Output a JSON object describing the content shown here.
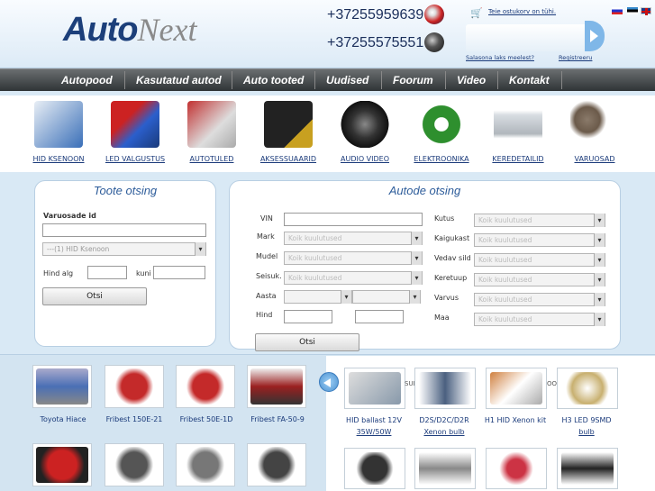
{
  "header": {
    "logo": {
      "part1": "Auto",
      "part2": "Next"
    },
    "phones": [
      "+37255959639",
      "+37255575551"
    ],
    "cart": {
      "link": "Teie ostukorv on tühi.",
      "forgot": "Salasona laks meelest?",
      "register": "Registreeru"
    },
    "languages": [
      "ru",
      "ee",
      "en"
    ]
  },
  "nav": {
    "items": [
      "Autopood",
      "Kasutatud autod",
      "Auto tooted",
      "Uudised",
      "Foorum",
      "Video",
      "Kontakt"
    ]
  },
  "categories": [
    {
      "label": "HID KSENOON",
      "color": "#3a6fb8"
    },
    {
      "label": "LED VALGUSTUS",
      "color": "#2b5fcc"
    },
    {
      "label": "AUTOTULED",
      "color": "#c23030"
    },
    {
      "label": "AKSESSUAARID",
      "color": "#c8a020"
    },
    {
      "label": "AUDIO VIDEO",
      "color": "#333333"
    },
    {
      "label": "ELEKTROONIKA",
      "color": "#2e8f2e"
    },
    {
      "label": "KEREDETAILID",
      "color": "#b0b6bc"
    },
    {
      "label": "VARUOSAD",
      "color": "#6b5a4a"
    }
  ],
  "toote": {
    "title": "Toote otsing",
    "varuosade_label": "Varuosade id",
    "category_select": "---(1) HID Ksenoon",
    "hind_alg": "Hind alg",
    "kuni": "kuni",
    "search_button": "Otsi"
  },
  "autode": {
    "title": "Autode otsing",
    "left_labels": [
      "VIN",
      "Mark",
      "Mudel",
      "Seisuk.",
      "Aasta",
      "Hind"
    ],
    "right_labels": [
      "Kutus",
      "Kaigukast",
      "Vedav sild",
      "Keretuup",
      "Varvus",
      "Maa"
    ],
    "placeholder": "Koik kuulutused",
    "search_button": "Otsi"
  },
  "used_cars": [
    {
      "label": "Toyota Hiace",
      "color": "#4a6fb5"
    },
    {
      "label": "Fribest 150E-21",
      "color": "#c42a2a"
    },
    {
      "label": "Fribest 50E-1D",
      "color": "#c42a2a"
    },
    {
      "label": "Fribest FA-50-9",
      "color": "#9b2020"
    },
    {
      "label": "",
      "color": "#cc2222"
    },
    {
      "label": "",
      "color": "#555555"
    },
    {
      "label": "",
      "color": "#777777"
    },
    {
      "label": "",
      "color": "#444444"
    }
  ],
  "products": [
    {
      "line1": "HID ballast 12V",
      "line2": "35W/50W",
      "color": "#8899aa"
    },
    {
      "line1": "D2S/D2C/D2R",
      "line2": "Xenon bulb",
      "color": "#4a6080"
    },
    {
      "line1": "H1 HID Xenon kit",
      "line2": "",
      "color": "#d08040"
    },
    {
      "line1": "H3 LED 9SMD",
      "line2": "bulb",
      "color": "#c8b070"
    },
    {
      "line1": "",
      "line2": "",
      "color": "#333333"
    },
    {
      "line1": "",
      "line2": "",
      "color": "#888888"
    },
    {
      "line1": "",
      "line2": "",
      "color": "#cc3344"
    },
    {
      "line1": "",
      "line2": "",
      "color": "#222222"
    }
  ],
  "strip_partial": [
    "SUI",
    "OO"
  ]
}
